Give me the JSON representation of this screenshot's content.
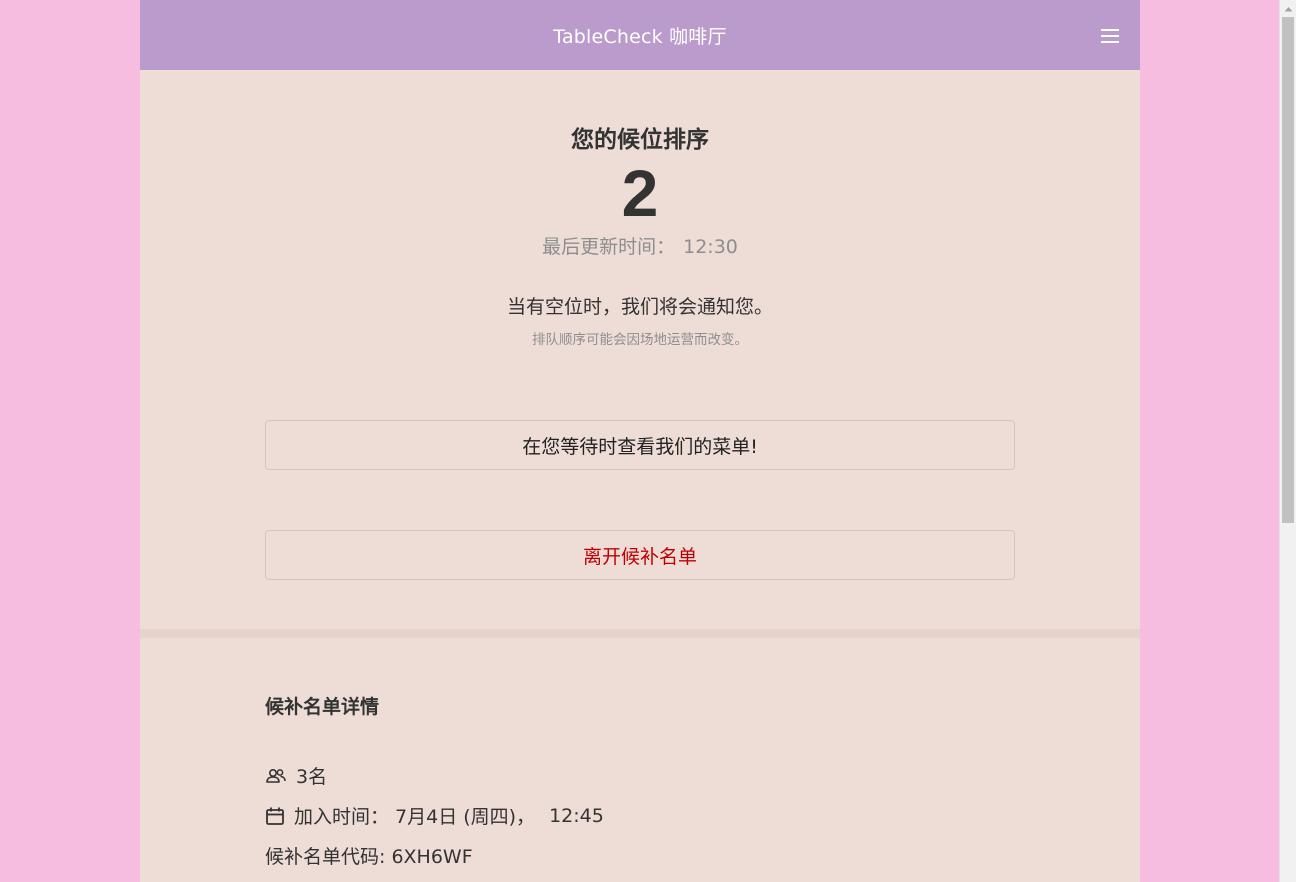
{
  "header": {
    "title": "TableCheck 咖啡厅"
  },
  "status": {
    "rank_label": "您的候位排序",
    "rank_number": "2",
    "updated_label": "最后更新时间：",
    "updated_time": "12:30",
    "notice": "当有空位时，我们将会通知您。",
    "subnotice": "排队顺序可能会因场地运营而改变。"
  },
  "actions": {
    "menu_label": "在您等待时查看我们的菜单!",
    "leave_label": "离开候补名单"
  },
  "details": {
    "title": "候补名单详情",
    "party_size": "3名",
    "joined_label": "加入时间：",
    "joined_date": "7月4日 (周四)，",
    "joined_time": "12:45",
    "code_text": "候补名单代码: 6XH6WF"
  },
  "colors": {
    "page_bg": "#f7bde0",
    "header_bg": "#bb9bcb",
    "content_bg": "#eeddd6",
    "leave_text": "#c00000"
  },
  "icons": {
    "menu": "hamburger-menu-icon",
    "party": "people-icon",
    "calendar": "calendar-icon"
  }
}
